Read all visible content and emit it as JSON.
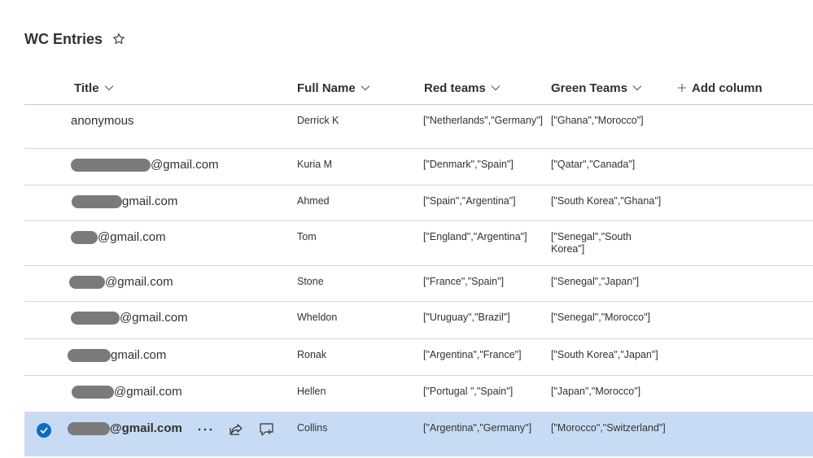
{
  "list": {
    "title": "WC Entries"
  },
  "columns": {
    "title": "Title",
    "full_name": "Full Name",
    "red_teams": "Red teams",
    "green_teams": "Green Teams",
    "add_column": "Add column"
  },
  "rows": [
    {
      "title": "anonymous",
      "full_name": "Derrick K",
      "red": "[\"Netherlands\",\"Germany\"]",
      "green": "[\"Ghana\",\"Morocco\"]"
    },
    {
      "title": "@gmail.com",
      "full_name": "Kuria M",
      "red": "[\"Denmark\",\"Spain\"]",
      "green": "[\"Qatar\",\"Canada\"]"
    },
    {
      "title": "gmail.com",
      "full_name": "Ahmed",
      "red": "[\"Spain\",\"Argentina\"]",
      "green": "[\"South Korea\",\"Ghana\"]"
    },
    {
      "title": "@gmail.com",
      "full_name": "Tom",
      "red": "[\"England\",\"Argentina\"]",
      "green": "[\"Senegal\",\"South Korea\"]"
    },
    {
      "title": "@gmail.com",
      "full_name": "Stone",
      "red": "[\"France\",\"Spain\"]",
      "green": "[\"Senegal\",\"Japan\"]"
    },
    {
      "title": "@gmail.com",
      "full_name": "Wheldon",
      "red": "[\"Uruguay\",\"Brazil\"]",
      "green": "[\"Senegal\",\"Morocco\"]"
    },
    {
      "title": "gmail.com",
      "full_name": "Ronak",
      "red": "[\"Argentina\",\"France\"]",
      "green": "[\"South Korea\",\"Japan\"]"
    },
    {
      "title": "@gmail.com",
      "full_name": "Hellen",
      "red": "[\"Portugal \",\"Spain\"]",
      "green": "[\"Japan\",\"Morocco\"]"
    },
    {
      "title": "@gmail.com",
      "full_name": "Collins",
      "red": "[\"Argentina\",\"Germany\"]",
      "green": "[\"Morocco\",\"Switzerland\"]"
    }
  ],
  "colors": {
    "selected_row": "#c7dcf4",
    "check_blue": "#0f6cbd",
    "text": "#323130"
  },
  "icons": {
    "favorite": "star-outline-icon",
    "sort": "chevron-down-icon",
    "add": "plus-icon",
    "select": "checkmark-circle-icon",
    "more": "ellipsis-icon",
    "share": "share-icon",
    "comment": "comment-add-icon"
  }
}
